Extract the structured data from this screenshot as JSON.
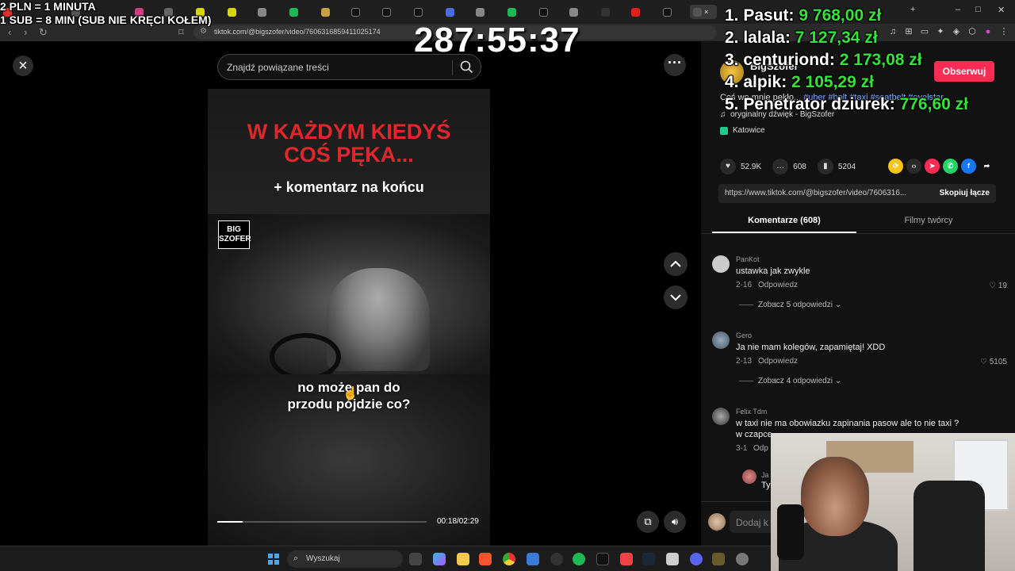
{
  "overlay": {
    "rate_line1": "2 PLN = 1 MINUTA",
    "rate_line2": "1 SUB = 8 MIN (SUB NIE KRĘCI KOŁEM)",
    "timer": "287:55:37",
    "leaderboard": [
      {
        "rank": "1. Pasut:",
        "amount": "9 768,00 zł"
      },
      {
        "rank": "2. lalala:",
        "amount": "7 127,34 zł"
      },
      {
        "rank": "3. centuriond:",
        "amount": "2 173,08 zł"
      },
      {
        "rank": "4. alpik:",
        "amount": "2 105,29 zł"
      },
      {
        "rank": "5. Penetrator dziurek:",
        "amount": "776,60 zł"
      }
    ]
  },
  "browser": {
    "url": "tiktok.com/@bigszofer/video/7606316859411025174"
  },
  "player": {
    "search_placeholder": "Znajdź powiązane treści",
    "title_line1": "W KAŻDYM KIEDYŚ",
    "title_line2": "COŚ PĘKA...",
    "subtitle_top": "+ komentarz na końcu",
    "logo_line1": "BIG",
    "logo_line2": "SZOFER",
    "caption_line1": "no może pan do",
    "caption_line2": "przodu pójdzie co?",
    "time": "00:18/02:29",
    "progress": 0.121
  },
  "panel": {
    "author": "BigSzofer",
    "follow_label": "Obserwuj",
    "description": "Coś we mnie pękło...",
    "hashtags": "#uber #bolt #taxi #seatbelt #eyelstar",
    "music": "oryginalny dźwięk - BigSzofer",
    "location": "Katowice",
    "likes": "52.9K",
    "comments": "608",
    "saves": "5204",
    "link": "https://www.tiktok.com/@bigszofer/video/7606316...",
    "copy_label": "Skopiuj łącze",
    "tab_comments": "Komentarze (608)",
    "tab_creator": "Filmy twórcy",
    "comment_placeholder": "Dodaj k"
  },
  "comments": [
    {
      "user": "PanKot",
      "text": "ustawka jak zwykle",
      "date": "2-16",
      "reply": "Odpowiedz",
      "likes": "19",
      "more": "Zobacz 5 odpowiedzi"
    },
    {
      "user": "Gero",
      "text": "Ja nie mam kolegów, zapamiętaj! XDD",
      "date": "2-13",
      "reply": "Odpowiedz",
      "likes": "5105",
      "more": "Zobacz 4 odpowiedzi"
    },
    {
      "user": "Felix Tdm",
      "text": "w taxi nie ma obowiazku zapinania pasow ale to nie taxi ?",
      "text2": "w czapce",
      "date": "3-1",
      "reply": "Odp"
    }
  ],
  "reply_preview": {
    "user": "Ja",
    "text": "Ty"
  },
  "taskbar": {
    "search_label": "Wyszukaj"
  },
  "colors": {
    "accent_red": "#fe2c55",
    "leaderboard_green": "#34e23a",
    "title_red": "#e2262b"
  }
}
